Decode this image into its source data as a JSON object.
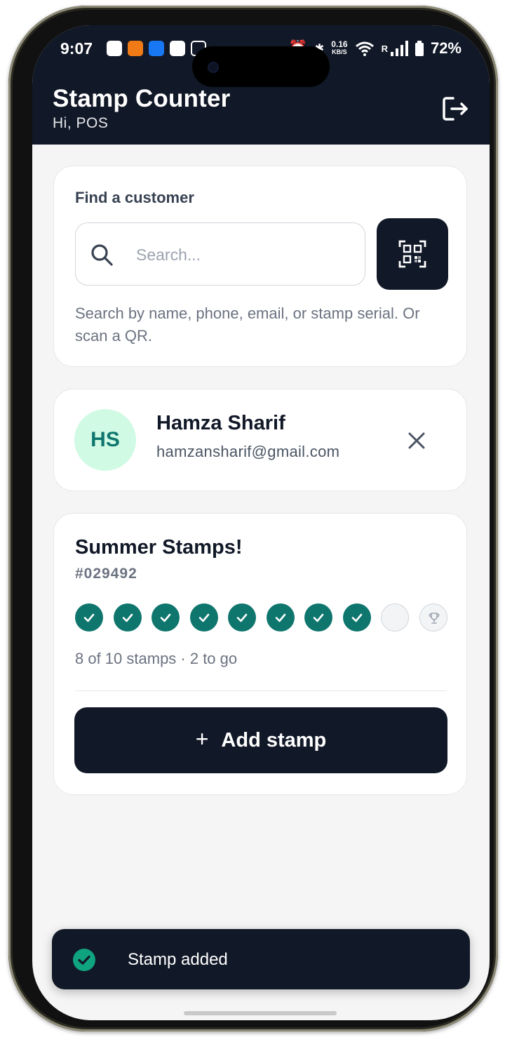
{
  "status_bar": {
    "time": "9:07",
    "net_speed_value": "0.16",
    "net_speed_unit": "KB/S",
    "roaming": "R",
    "battery": "72%"
  },
  "header": {
    "title": "Stamp Counter",
    "greeting": "Hi, POS"
  },
  "search": {
    "label": "Find a customer",
    "placeholder": "Search...",
    "hint": "Search by name, phone, email, or stamp serial. Or scan a QR."
  },
  "customer": {
    "initials": "HS",
    "name": "Hamza Sharif",
    "email": "hamzansharif@gmail.com"
  },
  "card": {
    "title": "Summer Stamps!",
    "serial": "#029492",
    "stamps_total": 10,
    "stamps_filled": 8,
    "progress_text": "8 of 10 stamps · 2 to go",
    "add_plus": "+",
    "add_label": "Add stamp"
  },
  "toast": {
    "message": "Stamp added"
  },
  "colors": {
    "header_bg": "#111827",
    "accent": "#0f766e",
    "avatar_bg": "#d1fae5"
  },
  "icons": [
    "logout-icon",
    "search-icon",
    "qr-scan-icon",
    "close-icon",
    "check-icon",
    "trophy-icon",
    "check-circle-icon"
  ]
}
